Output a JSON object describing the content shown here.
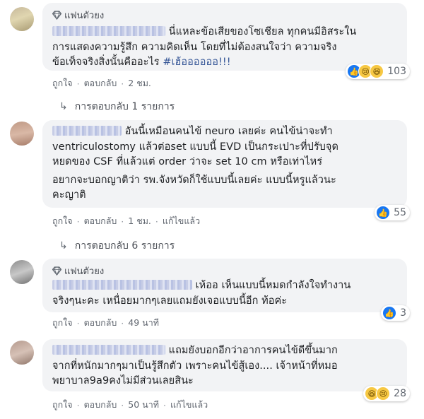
{
  "comments": [
    {
      "badge": "แฟนตัวยง",
      "lines": [
        "นี่แหละข้อเสียของโซเชียล ทุกคนมีอิสระใน",
        "การแสดงความรู้สึก ความคิดเห็น โดยที่ไม่ต้องสนใจว่า ความจริง",
        "ข้อเท็จจริงสิ่งนั้นคืออะไร"
      ],
      "hashtag": "#เฮ้ออออออ!!!",
      "reaction_count": "103",
      "reaction_icons": [
        "like-icon",
        "sad-icon",
        "haha-icon"
      ],
      "actions": {
        "like": "ถูกใจ",
        "reply": "ตอบกลับ",
        "time": "2 ชม."
      },
      "replies_label": "การตอบกลับ 1 รายการ"
    },
    {
      "lines": [
        "อันนี้เหมือนคนไข้ neuro เลยค่ะ คนไข้น่าจะทำ",
        "ventriculostomy แล้วต่อset แบบนี้ EVD เป็นกระเปาะที่ปรับจุด",
        "หยดของ CSF ที่แล้วแต่ order ว่าจะ set 10 cm หรือเท่าไหร่",
        "อยากจะบอกญาติว่า รพ.จังหวัดก็ใช้แบบนี้เลยค่ะ แบบนี้หรูแล้วนะ",
        "คะญาติ"
      ],
      "reaction_count": "55",
      "reaction_icons": [
        "like-icon"
      ],
      "actions": {
        "like": "ถูกใจ",
        "reply": "ตอบกลับ",
        "time": "1 ชม.",
        "edited": "แก้ไขแล้ว"
      },
      "replies_label": "การตอบกลับ 6 รายการ"
    },
    {
      "badge": "แฟนตัวยง",
      "lines": [
        "เห้ออ เห็นแบบนี้หมดกำลังใจทำงาน",
        "จริงๆนะคะ เหนื่อยมากๆเลยแถมยังเจอแบบนี้อีก ท้อค่ะ"
      ],
      "reaction_count": "3",
      "reaction_icons": [
        "like-icon"
      ],
      "actions": {
        "like": "ถูกใจ",
        "reply": "ตอบกลับ",
        "time": "49 นาที"
      }
    },
    {
      "lines": [
        "แถมยังบอกอีกว่าอาการคนไข้ดีขึ้นมาก",
        "จากที่หนักมากๆมาเป็นรู้สึกตัว เพราะคนไข้สู้เอง.... เจ้าหน้าที่หมอ",
        "พยาบาล9a9คงไม่มีส่วนเลยสินะ"
      ],
      "reaction_count": "28",
      "reaction_icons": [
        "haha-icon",
        "sad-icon"
      ],
      "actions": {
        "like": "ถูกใจ",
        "reply": "ตอบกลับ",
        "time": "50 นาที",
        "edited": "แก้ไขแล้ว"
      }
    }
  ]
}
